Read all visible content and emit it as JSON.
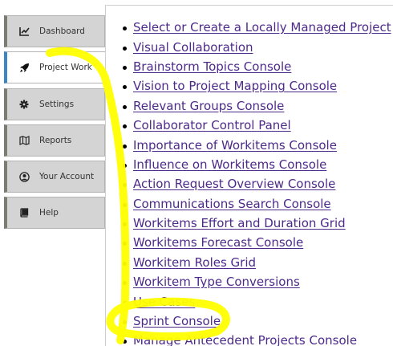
{
  "sidebar": {
    "items": [
      {
        "label": "Dashboard",
        "icon": "chart-line-icon"
      },
      {
        "label": "Project Work",
        "icon": "rocket-icon",
        "active": true
      },
      {
        "label": "Settings",
        "icon": "gear-icon"
      },
      {
        "label": "Reports",
        "icon": "map-icon"
      },
      {
        "label": "Your Account",
        "icon": "user-circle-icon"
      },
      {
        "label": "Help",
        "icon": "book-icon"
      }
    ]
  },
  "links": [
    "Select or Create a Locally Managed Project",
    "Visual Collaboration",
    "Brainstorm Topics Console",
    "Vision to Project Mapping Console",
    "Relevant Groups Console",
    "Collaborator Control Panel",
    "Importance of Workitems Console",
    "Influence on Workitems Console",
    "Action Request Overview Console",
    "Communications Search Console",
    "Workitems Effort and Duration Grid",
    "Workitems Forecast Console",
    "Workitem Roles Grid",
    "Workitem Type Conversions",
    "Use Cases",
    "Sprint Console",
    "Manage Antecedent Projects Console"
  ],
  "colors": {
    "link": "#4d2a8a",
    "active_accent": "#3b86c6",
    "annotation": "#ffff00"
  }
}
